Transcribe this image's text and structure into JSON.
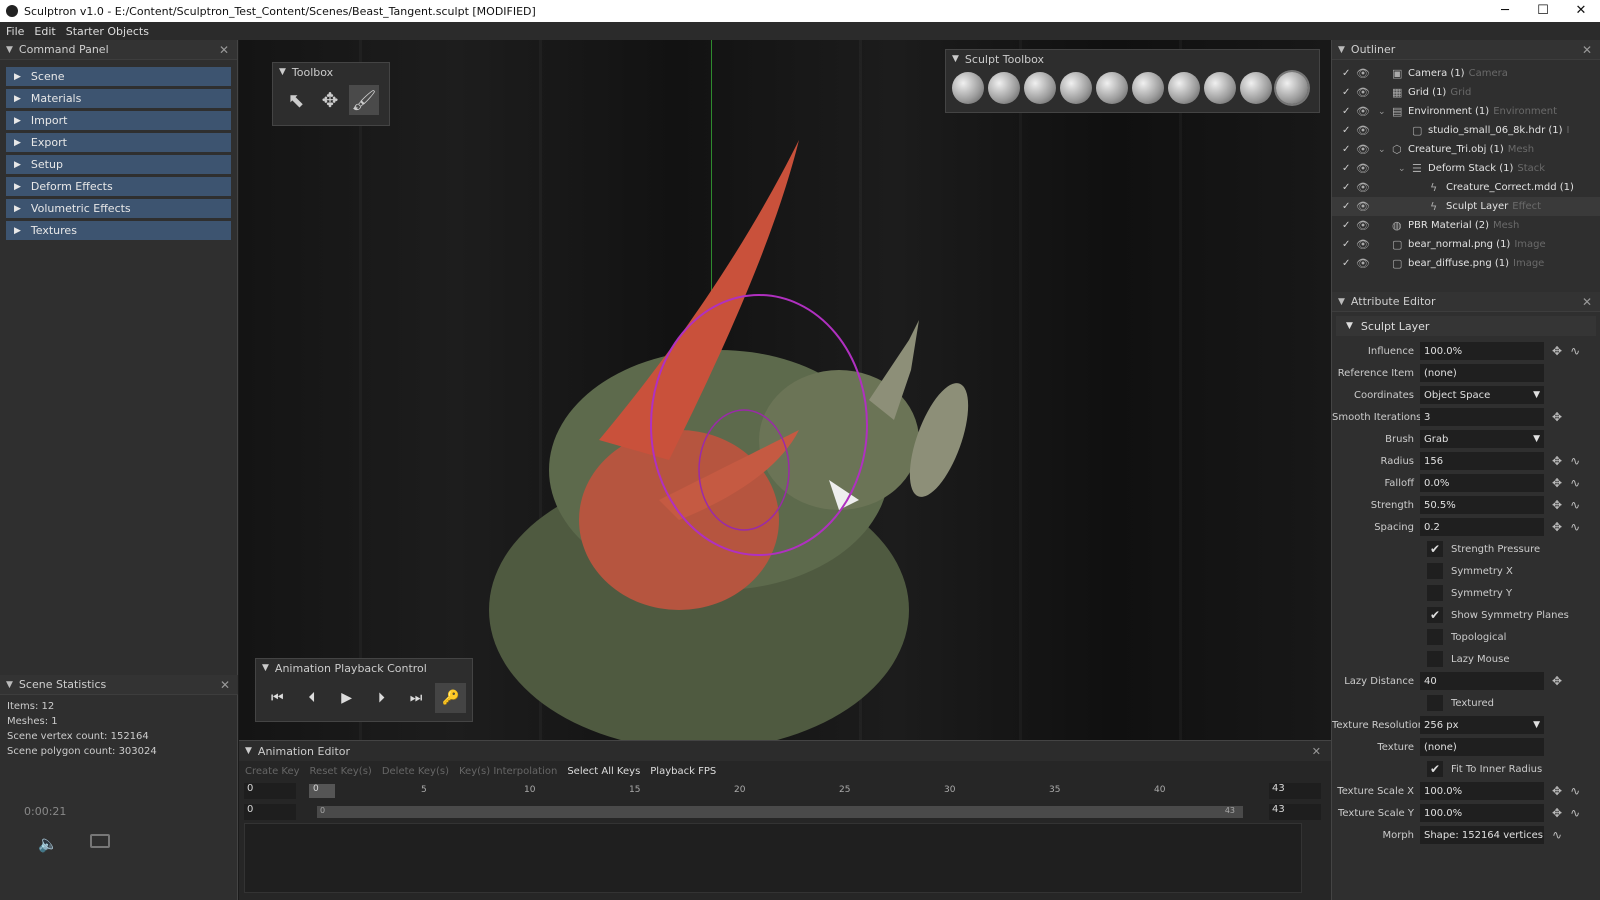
{
  "window": {
    "title": "Sculptron v1.0 - E:/Content/Sculptron_Test_Content/Scenes/Beast_Tangent.sculpt [MODIFIED]",
    "minimize": "─",
    "maximize": "☐",
    "close": "✕"
  },
  "menu": [
    "File",
    "Edit",
    "Starter Objects"
  ],
  "command_panel": {
    "title": "Command Panel",
    "items": [
      "Scene",
      "Materials",
      "Import",
      "Export",
      "Setup",
      "Deform Effects",
      "Volumetric Effects",
      "Textures"
    ]
  },
  "scene_stats": {
    "title": "Scene Statistics",
    "lines": [
      "Items: 12",
      "Meshes: 1",
      "Scene vertex count: 152164",
      "Scene polygon count: 303024"
    ]
  },
  "timecode": "0:00:21",
  "toolbox": {
    "title": "Toolbox"
  },
  "sculpt_toolbox": {
    "title": "Sculpt Toolbox"
  },
  "playback": {
    "title": "Animation Playback Control"
  },
  "anim_editor": {
    "title": "Animation Editor",
    "toolbar": [
      "Create Key",
      "Reset Key(s)",
      "Delete Key(s)",
      "Key(s) Interpolation",
      "Select All Keys",
      "Playback FPS"
    ],
    "start": "0",
    "current": "0",
    "end": "43",
    "ticks": [
      "5",
      "10",
      "15",
      "20",
      "25",
      "30",
      "35",
      "40"
    ],
    "track_start": "0",
    "track_end": "43",
    "track_bar_start": "0",
    "track_bar_end": "43"
  },
  "outliner": {
    "title": "Outliner",
    "rows": [
      {
        "name": "Camera (1)",
        "type": "Camera"
      },
      {
        "name": "Grid (1)",
        "type": "Grid"
      },
      {
        "name": "Environment (1)",
        "type": "Environment"
      },
      {
        "name": "studio_small_06_8k.hdr (1)",
        "type": "I"
      },
      {
        "name": "Creature_Tri.obj (1)",
        "type": "Mesh"
      },
      {
        "name": "Deform Stack (1)",
        "type": "Stack"
      },
      {
        "name": "Creature_Correct.mdd (1)",
        "type": ""
      },
      {
        "name": "Sculpt Layer",
        "type": "Effect"
      },
      {
        "name": "PBR Material (2)",
        "type": "Mesh"
      },
      {
        "name": "bear_normal.png (1)",
        "type": "Image"
      },
      {
        "name": "bear_diffuse.png (1)",
        "type": "Image"
      }
    ]
  },
  "attribute_editor": {
    "title": "Attribute Editor",
    "section": "Sculpt Layer",
    "fields": [
      {
        "label": "Influence",
        "value": "100.0%"
      },
      {
        "label": "Reference Item",
        "value": "(none)"
      },
      {
        "label": "Coordinates",
        "value": "Object Space"
      },
      {
        "label": "Smooth Iterations",
        "value": "3"
      },
      {
        "label": "Brush",
        "value": "Grab"
      },
      {
        "label": "Radius",
        "value": "156"
      },
      {
        "label": "Falloff",
        "value": "0.0%"
      },
      {
        "label": "Strength",
        "value": "50.5%"
      },
      {
        "label": "Spacing",
        "value": "0.2"
      }
    ],
    "checks": [
      {
        "label": "Strength Pressure",
        "checked": "✔"
      },
      {
        "label": "Symmetry X",
        "checked": ""
      },
      {
        "label": "Symmetry Y",
        "checked": ""
      },
      {
        "label": "Show Symmetry Planes",
        "checked": "✔"
      },
      {
        "label": "Topological",
        "checked": ""
      },
      {
        "label": "Lazy Mouse",
        "checked": ""
      }
    ],
    "lazy_distance": {
      "label": "Lazy Distance",
      "value": "40"
    },
    "textured": {
      "label": "Textured",
      "checked": ""
    },
    "fields2": [
      {
        "label": "Texture Resolution",
        "value": "256 px"
      },
      {
        "label": "Texture",
        "value": "(none)"
      }
    ],
    "fit": {
      "label": "Fit To Inner Radius",
      "checked": "✔"
    },
    "fields3": [
      {
        "label": "Texture Scale X",
        "value": "100.0%"
      },
      {
        "label": "Texture Scale Y",
        "value": "100.0%"
      },
      {
        "label": "Morph",
        "value": "Shape: 152164 vertices"
      }
    ]
  }
}
